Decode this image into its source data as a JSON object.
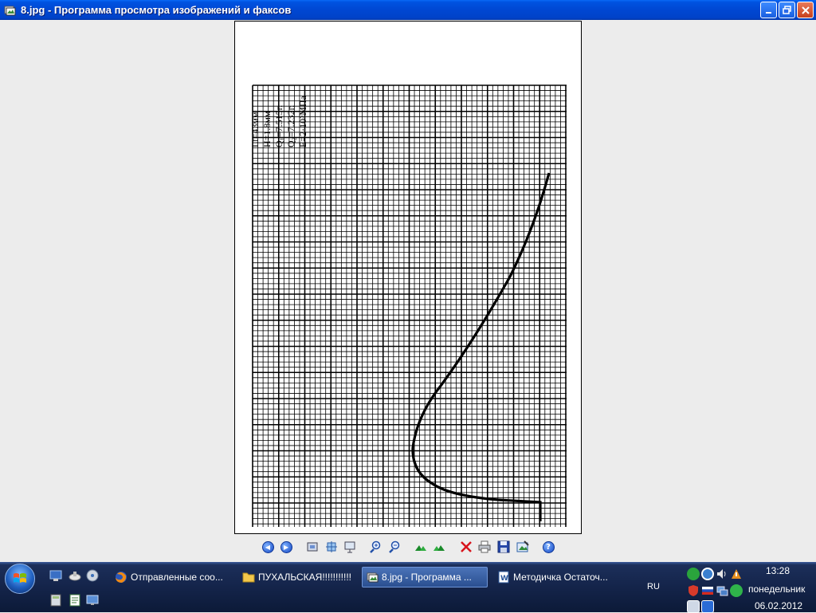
{
  "window": {
    "title": "8.jpg - Программа просмотра изображений и факсов",
    "minimize_icon": "minimize-icon",
    "restore_icon": "restore-icon",
    "close_icon": "close-icon"
  },
  "image": {
    "params": [
      "Lt=43мм",
      "H=1.8мм",
      "Q₁=7.515г.",
      "Q₂=7.232г.",
      "E=2·10⁵МПа"
    ]
  },
  "toolbar": {
    "buttons": [
      "previous-image",
      "next-image",
      "best-fit",
      "actual-size",
      "slideshow",
      "zoom-in",
      "zoom-out",
      "rotate-clockwise",
      "rotate-counterclockwise",
      "delete",
      "print",
      "save",
      "edit",
      "help"
    ]
  },
  "taskbar": {
    "tasks": [
      {
        "label": "Отправленные соо...",
        "icon": "firefox-icon"
      },
      {
        "label": "ПУХАЛЬСКАЯ!!!!!!!!!!!",
        "icon": "folder-icon"
      },
      {
        "label": "8.jpg - Программа ...",
        "icon": "image-viewer-icon",
        "active": true
      },
      {
        "label": "Методичка Остаточ...",
        "icon": "word-document-icon"
      }
    ],
    "language": "RU",
    "clock": {
      "time": "13:28",
      "day": "понедельник",
      "date": "06.02.2012"
    }
  }
}
